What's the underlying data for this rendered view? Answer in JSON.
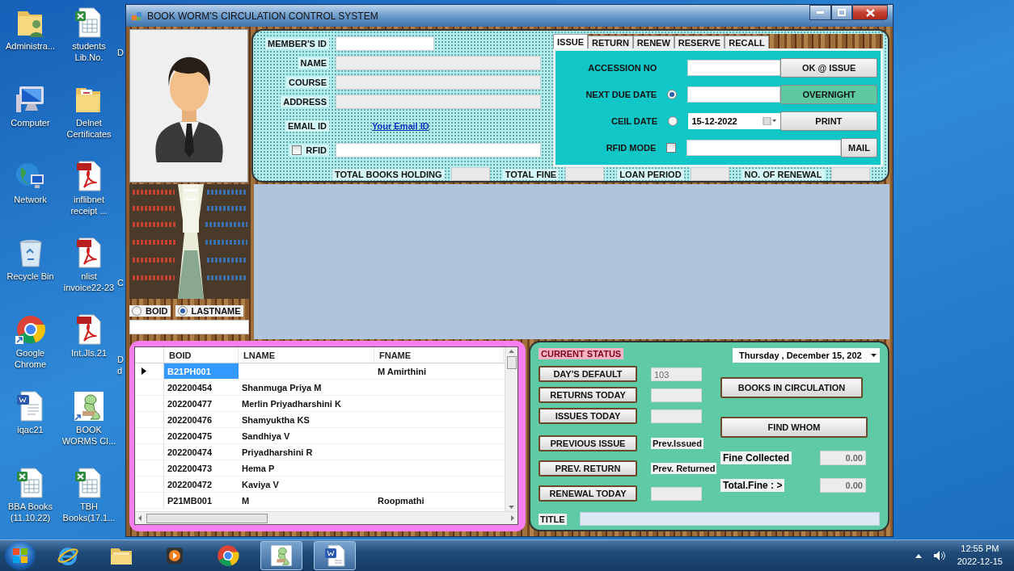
{
  "desktop": {
    "icons": [
      {
        "label": "Administra...",
        "kind": "user-folder"
      },
      {
        "label": "students Lib.No.",
        "kind": "spreadsheet",
        "edge_label": "D"
      },
      {
        "label": "Computer",
        "kind": "computer"
      },
      {
        "label": "Delnet Certificates",
        "kind": "folder"
      },
      {
        "label": "Network",
        "kind": "network"
      },
      {
        "label": "inflibnet receipt ...",
        "kind": "pdf"
      },
      {
        "label": "Recycle Bin",
        "kind": "recycle"
      },
      {
        "label": "nlist invoice22-23",
        "kind": "pdf",
        "edge_label": "C"
      },
      {
        "label": "Google Chrome",
        "kind": "browser"
      },
      {
        "label": "Int.Jls.21",
        "kind": "pdf",
        "edge_label": "D d"
      },
      {
        "label": "iqac21",
        "kind": "document"
      },
      {
        "label": "BOOK WORMS CI...",
        "kind": "worm"
      },
      {
        "label": "BBA Books (11.10.22)",
        "kind": "spreadsheet"
      },
      {
        "label": "TBH Books(17.1...",
        "kind": "spreadsheet"
      }
    ]
  },
  "window": {
    "title": "BOOK WORM'S CIRCULATION CONTROL SYSTEM"
  },
  "member": {
    "fields": [
      {
        "label": "MEMBER'S ID",
        "kind": "entry"
      },
      {
        "label": "NAME",
        "kind": "readonly"
      },
      {
        "label": "COURSE",
        "kind": "readonly"
      },
      {
        "label": "ADDRESS",
        "kind": "readonly"
      },
      {
        "label": "EMAIL ID",
        "kind": "link",
        "value": "Your Email ID"
      },
      {
        "label": "RFID",
        "kind": "check",
        "checked": false
      }
    ]
  },
  "totals": [
    {
      "label": "TOTAL BOOKS HOLDING"
    },
    {
      "label": "TOTAL FINE"
    },
    {
      "label": "LOAN PERIOD"
    },
    {
      "label": "NO. OF RENEWAL"
    }
  ],
  "tabs": [
    {
      "label": "ISSUE",
      "selected": true
    },
    {
      "label": "RETURN",
      "selected": false
    },
    {
      "label": "RENEW",
      "selected": false
    },
    {
      "label": "RESERVE",
      "selected": false
    },
    {
      "label": "RECALL",
      "selected": false
    }
  ],
  "issue": {
    "rows": [
      {
        "label": "ACCESSION NO",
        "kind": "text",
        "button": {
          "label": "OK @ ISSUE",
          "highlighted": false
        }
      },
      {
        "label": "NEXT DUE DATE",
        "kind": "radio",
        "selected": true,
        "button": {
          "label": "OVERNIGHT",
          "highlighted": true
        }
      },
      {
        "label": "CEIL DATE",
        "kind": "radio-date",
        "selected": false,
        "value": "15-12-2022",
        "button": {
          "label": "PRINT",
          "highlighted": false
        }
      },
      {
        "label": "RFID MODE",
        "kind": "check",
        "checked": false,
        "button": {
          "label": "MAIL",
          "highlighted": false
        }
      }
    ]
  },
  "search": {
    "options": [
      {
        "label": "BOID",
        "selected": false
      },
      {
        "label": "LASTNAME",
        "selected": true
      }
    ]
  },
  "table": {
    "columns": [
      "BOID",
      "LNAME",
      "FNAME"
    ],
    "rows": [
      {
        "cells": [
          "B21PH001",
          null,
          "M Amirthini"
        ],
        "selected": true
      },
      {
        "cells": [
          "202200454",
          "Shanmuga Priya M",
          null
        ],
        "selected": false
      },
      {
        "cells": [
          "202200477",
          "Merlin Priyadharshini K",
          null
        ],
        "selected": false
      },
      {
        "cells": [
          "202200476",
          "Shamyuktha  KS",
          null
        ],
        "selected": false
      },
      {
        "cells": [
          "202200475",
          "Sandhiya V",
          null
        ],
        "selected": false
      },
      {
        "cells": [
          "202200474",
          "Priyadharshini R",
          null
        ],
        "selected": false
      },
      {
        "cells": [
          "202200473",
          "Hema P",
          null
        ],
        "selected": false
      },
      {
        "cells": [
          "202200472",
          "Kaviya V",
          null
        ],
        "selected": false
      },
      {
        "cells": [
          "P21MB001",
          "M",
          "Roopmathi"
        ],
        "selected": false
      }
    ]
  },
  "status": {
    "heading": "CURRENT STATUS",
    "date": "Thursday , December 15, 202",
    "counters": [
      {
        "button": "DAY'S DEFAULT",
        "kind": "box",
        "value": "103"
      },
      {
        "button": "RETURNS TODAY",
        "kind": "box"
      },
      {
        "button": "ISSUES TODAY",
        "kind": "box"
      },
      {
        "button": "PREVIOUS ISSUE",
        "kind": "label",
        "value": "Prev.Issued"
      },
      {
        "button": "PREV. RETURN",
        "kind": "label",
        "value": "Prev. Returned"
      },
      {
        "button": "RENEWAL TODAY",
        "kind": "box"
      }
    ],
    "actions": [
      "BOOKS IN CIRCULATION",
      "FIND WHOM"
    ],
    "fines": [
      {
        "label": "Fine Collected",
        "value": "0.00"
      },
      {
        "label": "Total.Fine : >",
        "value": "0.00"
      }
    ],
    "title_label": "TITLE"
  },
  "taskbar": {
    "apps": [
      {
        "kind": "ie",
        "open": false
      },
      {
        "kind": "explorer",
        "open": false
      },
      {
        "kind": "player",
        "open": false
      },
      {
        "kind": "browser",
        "open": false
      },
      {
        "kind": "worm",
        "open": true
      },
      {
        "kind": "document",
        "open": true
      }
    ],
    "time": "12:55 PM",
    "date": "2022-12-15"
  }
}
